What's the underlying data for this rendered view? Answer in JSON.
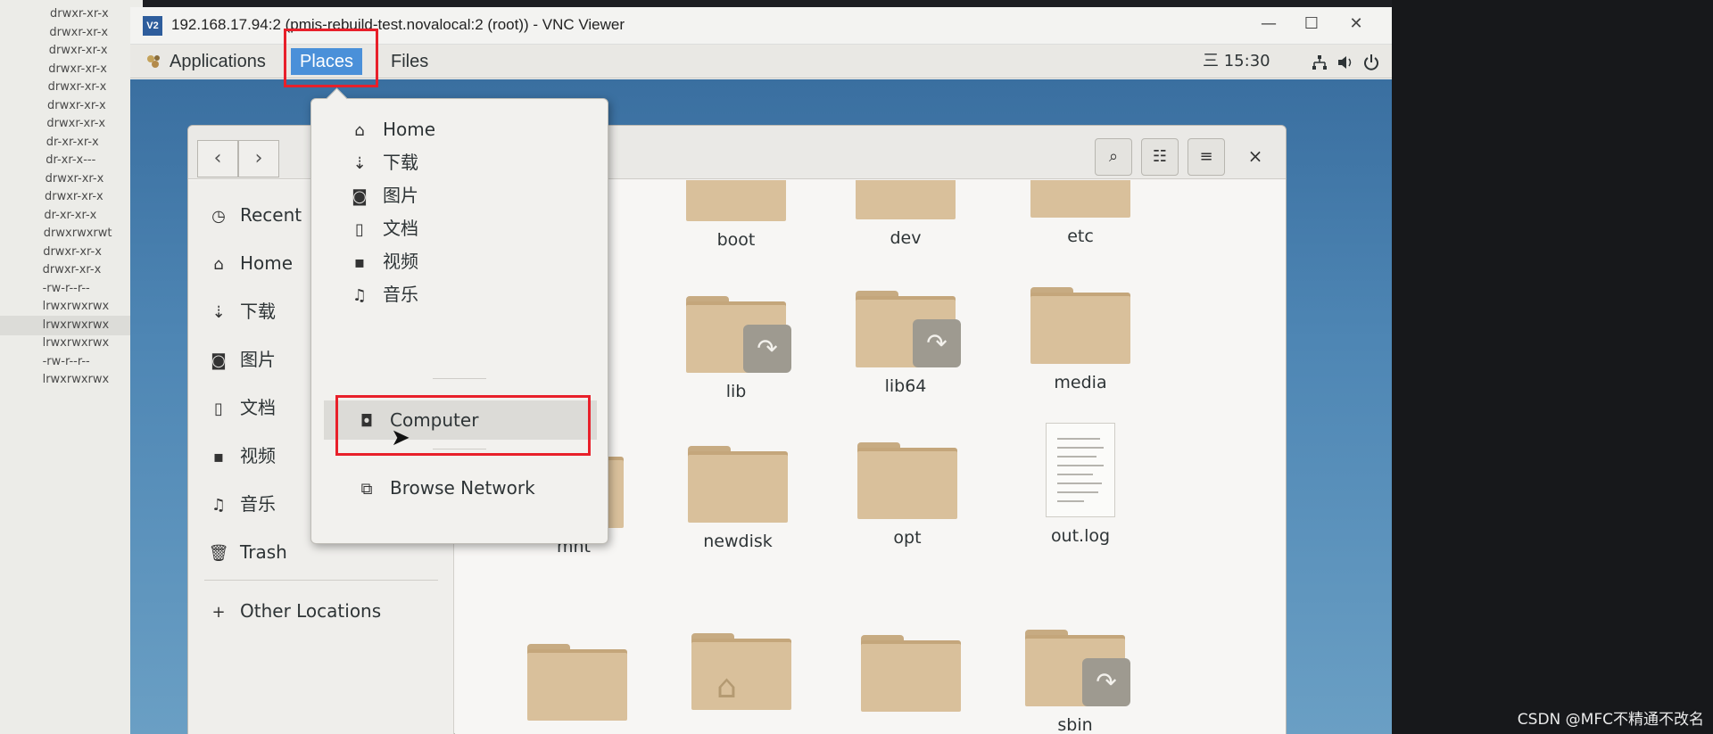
{
  "terminal": {
    "lines": [
      "drwxr-xr-x",
      "drwxr-xr-x",
      "drwxr-xr-x",
      "drwxr-xr-x",
      "drwxr-xr-x",
      "drwxr-xr-x",
      "drwxr-xr-x",
      "dr-xr-xr-x",
      "dr-xr-x---",
      "drwxr-xr-x",
      "drwxr-xr-x",
      "dr-xr-xr-x",
      "drwxrwxrwt",
      "drwxr-xr-x",
      "drwxr-xr-x",
      "-rw-r--r--",
      "lrwxrwxrwx",
      "lrwxrwxrwx",
      "lrwxrwxrwx",
      "-rw-r--r--",
      "lrwxrwxrwx"
    ]
  },
  "vnc": {
    "title": "192.168.17.94:2 (pmis-rebuild-test.novalocal:2 (root)) - VNC Viewer",
    "logo": "V2",
    "minimize": "—",
    "maximize": "☐",
    "close": "✕"
  },
  "topbar": {
    "applications": "Applications",
    "places": "Places",
    "files": "Files",
    "time": "15:30",
    "time_prefix": "三",
    "network_icon": "network-icon",
    "volume_icon": "volume-icon",
    "power_icon": "power-icon"
  },
  "places_menu": {
    "items": [
      {
        "label": "Home",
        "icon": "⌂"
      },
      {
        "label": "下载",
        "icon": "⇣"
      },
      {
        "label": "图片",
        "icon": "◙"
      },
      {
        "label": "文档",
        "icon": "▯"
      },
      {
        "label": "视频",
        "icon": "▪"
      },
      {
        "label": "音乐",
        "icon": "♫"
      }
    ],
    "computer": "Computer",
    "browse_network": "Browse Network"
  },
  "sidebar": {
    "items": [
      {
        "label": "Recent",
        "icon": "◷"
      },
      {
        "label": "Home",
        "icon": "⌂"
      },
      {
        "label": "下载",
        "icon": "⇣"
      },
      {
        "label": "图片",
        "icon": "◙"
      },
      {
        "label": "文档",
        "icon": "▯"
      },
      {
        "label": "视频",
        "icon": "▪"
      },
      {
        "label": "音乐",
        "icon": "♫"
      },
      {
        "label": "Trash",
        "icon": "🗑"
      }
    ],
    "other_locations": "Other Locations",
    "plus": "+"
  },
  "header": {
    "back": "‹",
    "forward": "›",
    "search_icon": "⌕",
    "view_icon": "☷",
    "menu_icon": "≡",
    "close": "×"
  },
  "files": {
    "row1": [
      "boot",
      "dev",
      "etc"
    ],
    "row2": [
      "lib",
      "lib64",
      "media"
    ],
    "row3": [
      "mnt",
      "newdisk",
      "opt",
      "out.log"
    ],
    "row4_last": "sbin"
  },
  "watermark": "CSDN @MFC不精通不改名",
  "colors": {
    "accent": "#4a90d9",
    "highlight_box": "#e8202a",
    "folder": "#d9c09b"
  }
}
